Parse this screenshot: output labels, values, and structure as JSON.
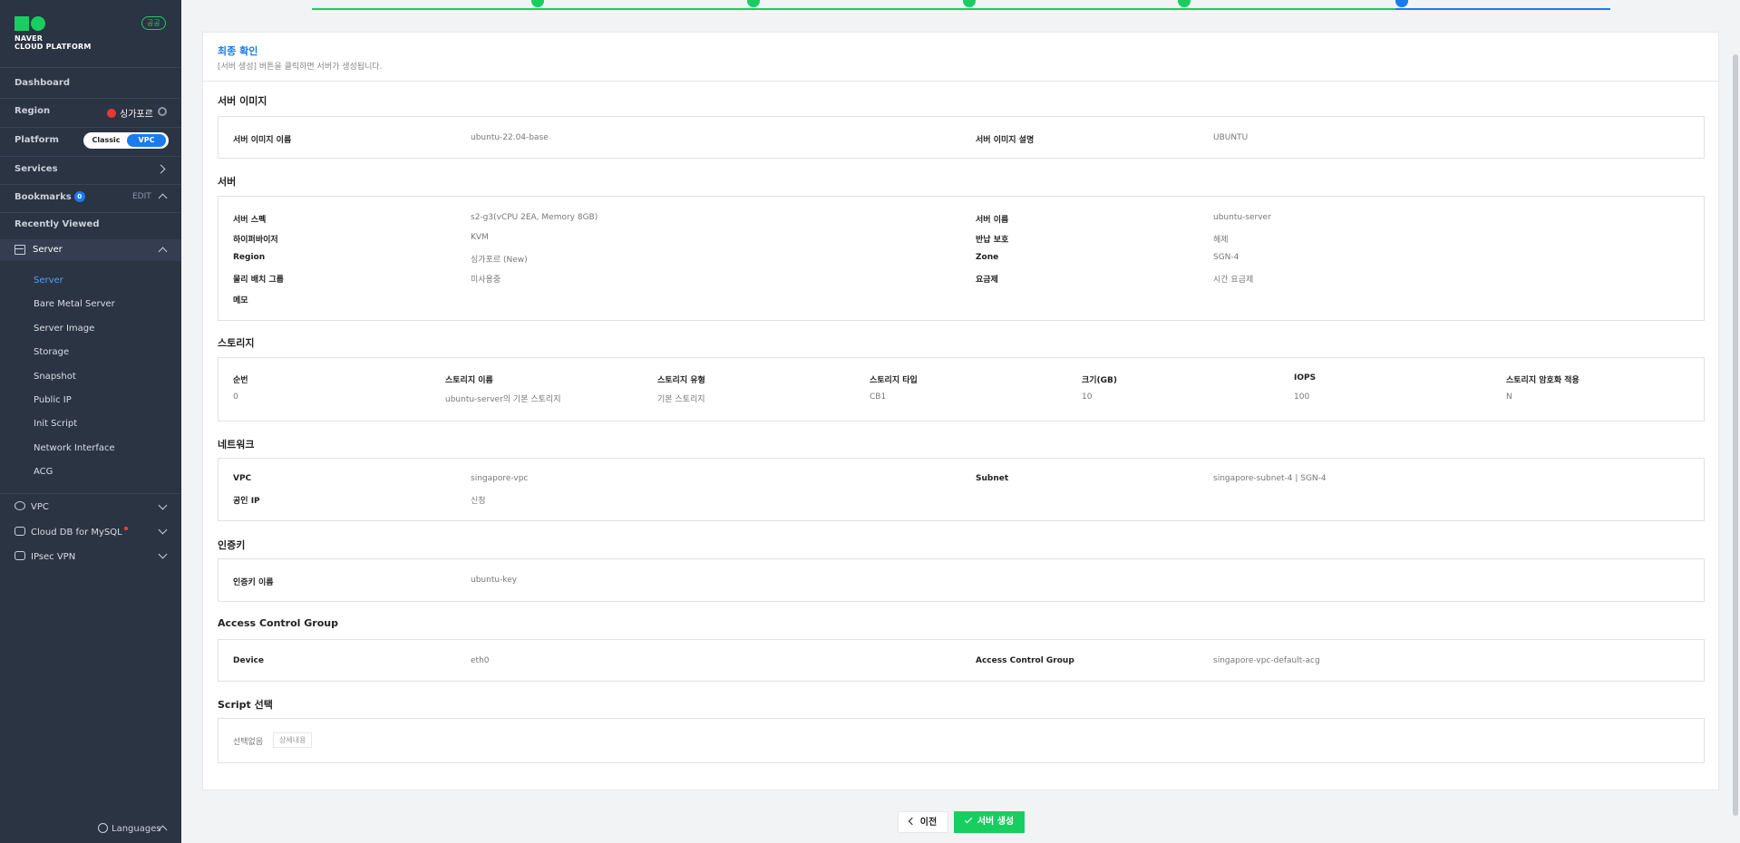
{
  "sidebar": {
    "logo_line1": "NAVER",
    "logo_line2": "CLOUD PLATFORM",
    "gov_badge": "공공",
    "dashboard": "Dashboard",
    "region_label": "Region",
    "region_value": "싱가포르",
    "platform_label": "Platform",
    "platform_classic": "Classic",
    "platform_vpc": "VPC",
    "services": "Services",
    "bookmarks": "Bookmarks",
    "bookmarks_count": "0",
    "edit": "EDIT",
    "recently_viewed": "Recently Viewed",
    "server_group": "Server",
    "server_items": [
      "Server",
      "Bare Metal Server",
      "Server Image",
      "Storage",
      "Snapshot",
      "Public IP",
      "Init Script",
      "Network Interface",
      "ACG"
    ],
    "groups": [
      "VPC",
      "Cloud DB for MySQL",
      "IPsec VPN"
    ],
    "languages": "Languages"
  },
  "stepper": {
    "done_color": "#19ce60",
    "current_color": "#1a7bf0"
  },
  "header": {
    "title": "최종 확인",
    "desc": "[서버 생성] 버튼을 클릭하면 서버가 생성됩니다."
  },
  "server_image": {
    "title": "서버 이미지",
    "name_label": "서버 이미지 이름",
    "name_value": "ubuntu-22.04-base",
    "desc_label": "서버 이미지 설명",
    "desc_value": "UBUNTU"
  },
  "server": {
    "title": "서버",
    "spec_label": "서버 스펙",
    "spec_value": "s2-g3(vCPU 2EA, Memory 8GB)",
    "hypervisor_label": "하이퍼바이저",
    "hypervisor_value": "KVM",
    "region_label": "Region",
    "region_value": "싱가포르 (New)",
    "placement_label": "물리 배치 그룹",
    "placement_value": "미사용중",
    "memo_label": "메모",
    "name_label": "서버 이름",
    "name_value": "ubuntu-server",
    "protect_label": "반납 보호",
    "protect_value": "해제",
    "zone_label": "Zone",
    "zone_value": "SGN-4",
    "plan_label": "요금제",
    "plan_value": "시간 요금제"
  },
  "storage": {
    "title": "스토리지",
    "headers": [
      "순번",
      "스토리지 이름",
      "스토리지 유형",
      "스토리지 타입",
      "크기(GB)",
      "IOPS",
      "스토리지 암호화 적용"
    ],
    "row": [
      "0",
      "ubuntu-server의 기본 스토리지",
      "기본 스토리지",
      "CB1",
      "10",
      "100",
      "N"
    ]
  },
  "network": {
    "title": "네트워크",
    "vpc_label": "VPC",
    "vpc_value": "singapore-vpc",
    "public_ip_label": "공인 IP",
    "public_ip_value": "신청",
    "subnet_label": "Subnet",
    "subnet_value": "singapore-subnet-4 | SGN-4"
  },
  "auth": {
    "title": "인증키",
    "key_label": "인증키 이름",
    "key_value": "ubuntu-key"
  },
  "acg": {
    "title": "Access Control Group",
    "device_label": "Device",
    "device_value": "eth0",
    "acg_label": "Access Control Group",
    "acg_value": "singapore-vpc-default-acg"
  },
  "script": {
    "title": "Script 선택",
    "none": "선택없음",
    "detail": "상세내용"
  },
  "buttons": {
    "prev": "이전",
    "create": "서버 생성"
  }
}
